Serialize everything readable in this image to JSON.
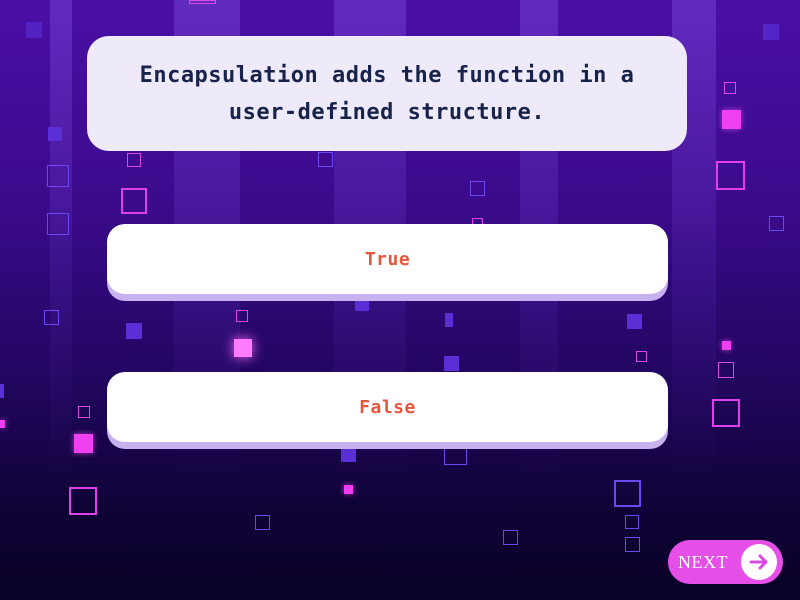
{
  "question": {
    "text": "Encapsulation adds the function in a user-defined structure."
  },
  "answers": [
    {
      "label": "True"
    },
    {
      "label": "False"
    }
  ],
  "navigation": {
    "next_label": "NEXT",
    "next_icon": "arrow-right-icon"
  },
  "colors": {
    "answer_text": "#e8553b",
    "question_text": "#17234a",
    "card_background": "#efeaf9",
    "next_button": "#e64ee8",
    "answer_shadow": "#c7b2ef"
  }
}
